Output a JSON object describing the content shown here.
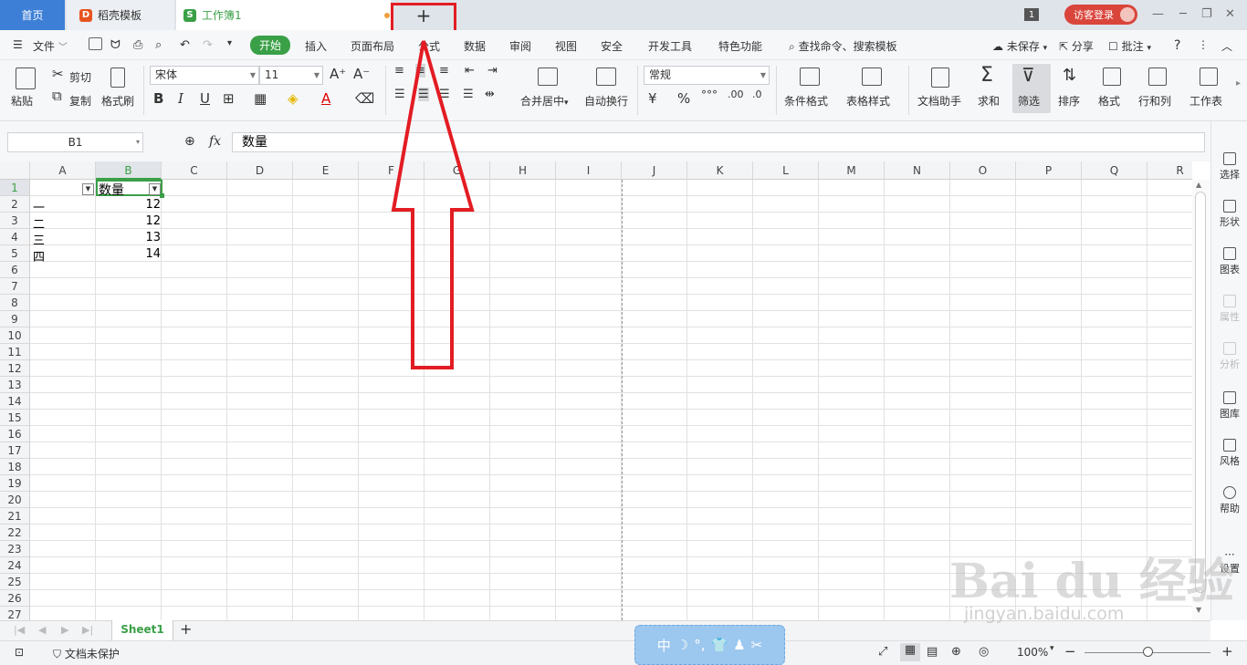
{
  "tabs": {
    "home": "首页",
    "daoke": "稻壳模板",
    "workbook": "工作簿1",
    "new_tab": "+"
  },
  "titlebar": {
    "window_count": "1",
    "login": "访客登录"
  },
  "menu": {
    "file": "文件",
    "items": [
      "开始",
      "插入",
      "页面布局",
      "公式",
      "数据",
      "审阅",
      "视图",
      "安全",
      "开发工具",
      "特色功能"
    ],
    "search": "查找命令、搜索模板",
    "unsaved": "未保存",
    "share": "分享",
    "annotate": "批注"
  },
  "ribbon": {
    "paste": "粘贴",
    "cut": "剪切",
    "copy": "复制",
    "format_painter": "格式刷",
    "font_name": "宋体",
    "font_size": "11",
    "merge_center": "合并居中",
    "auto_wrap": "自动换行",
    "number_format": "常规",
    "conditional_format": "条件格式",
    "table_style": "表格样式",
    "doc_assistant": "文档助手",
    "sum": "求和",
    "filter": "筛选",
    "sort": "排序",
    "format": "格式",
    "row_col": "行和列",
    "worksheet": "工作表"
  },
  "formula_bar": {
    "name_box": "B1",
    "fx": "fx",
    "value": "数量"
  },
  "grid": {
    "columns": [
      "A",
      "B",
      "C",
      "D",
      "E",
      "F",
      "G",
      "H",
      "I",
      "J",
      "K",
      "L",
      "M",
      "N",
      "O",
      "P",
      "Q",
      "R"
    ],
    "rows": [
      "1",
      "2",
      "3",
      "4",
      "5",
      "6",
      "7",
      "8",
      "9",
      "10",
      "11",
      "12",
      "13",
      "14",
      "15",
      "16",
      "17",
      "18",
      "19",
      "20",
      "21",
      "22",
      "23",
      "24",
      "25",
      "26",
      "27"
    ],
    "header_b1": "数量",
    "data": [
      {
        "a": "一",
        "b": "12"
      },
      {
        "a": "二",
        "b": "12"
      },
      {
        "a": "三",
        "b": "13"
      },
      {
        "a": "四",
        "b": "14"
      }
    ]
  },
  "side_panel": [
    "选择",
    "形状",
    "图表",
    "属性",
    "分析",
    "图库",
    "风格",
    "帮助",
    "设置"
  ],
  "sheets": {
    "active": "Sheet1",
    "add": "+"
  },
  "status": {
    "protection": "文档未保护",
    "zoom": "100%",
    "ime": "中"
  },
  "watermark": {
    "main": "Bai du 经验",
    "sub": "jingyan.baidu.com"
  },
  "colors": {
    "accent_green": "#3aa047",
    "tab_blue": "#3d7fd6",
    "annotation_red": "#e31c23"
  }
}
